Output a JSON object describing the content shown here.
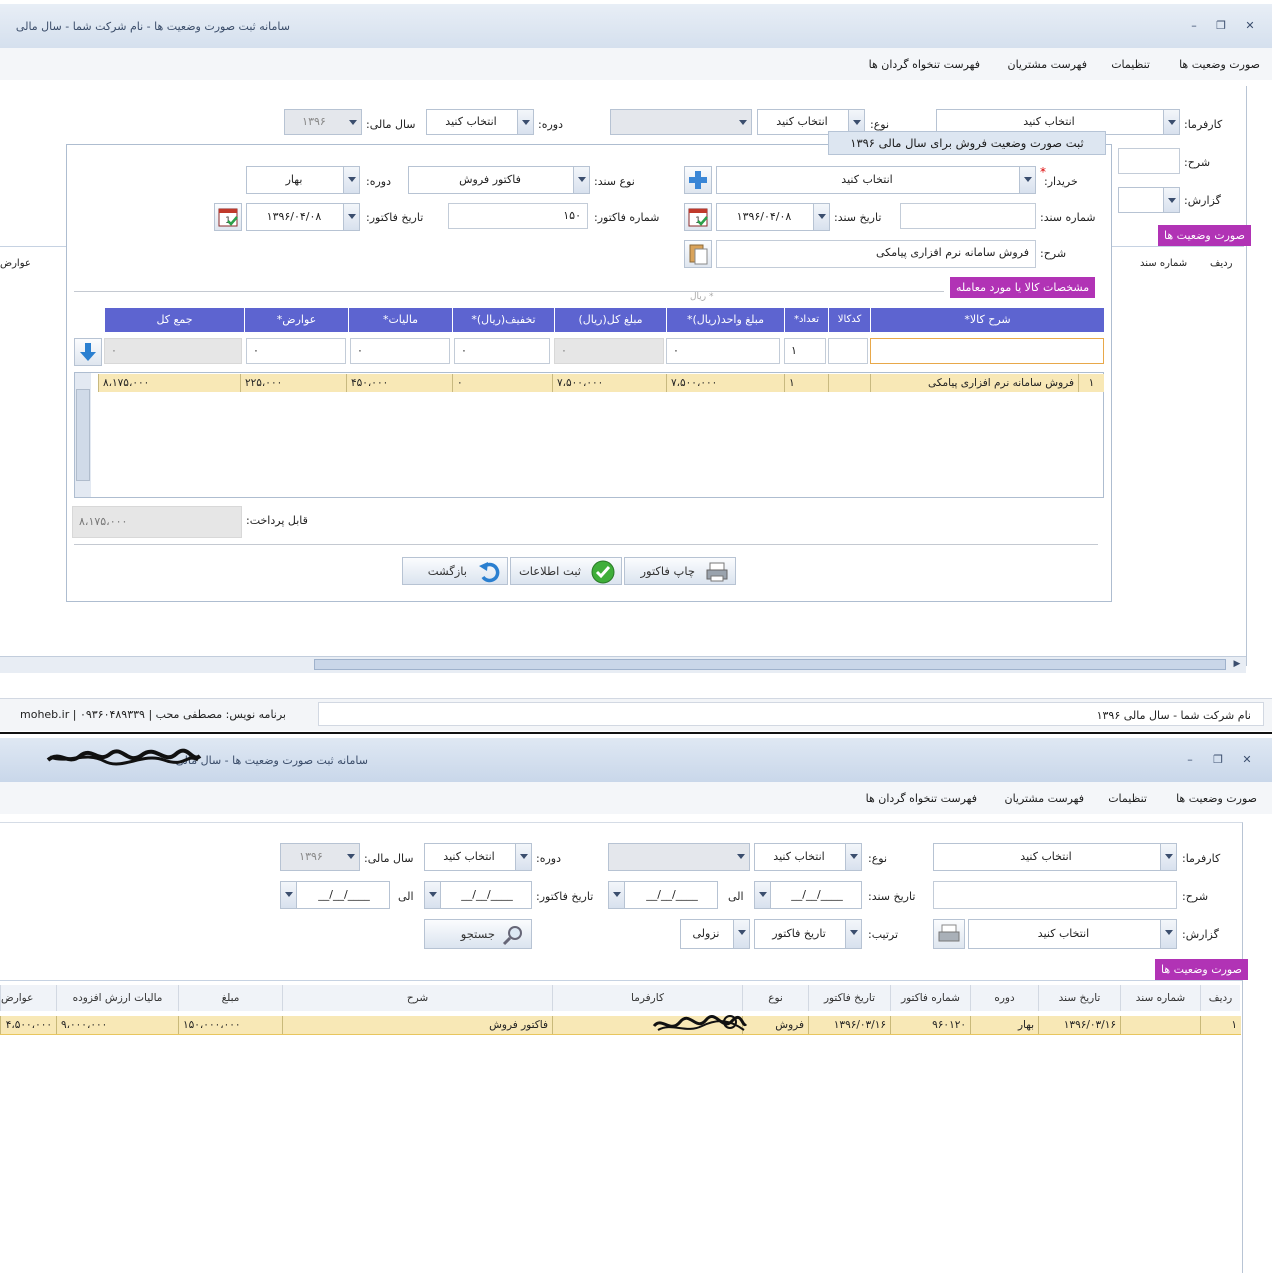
{
  "top": {
    "window_title": "سامانه ثبت صورت وضعیت ها - نام شرکت شما - سال مالی",
    "menu": [
      "صورت وضعیت ها",
      "تنظیمات",
      "فهرست مشتریان",
      "فهرست تنخواه گردان ها"
    ],
    "filters": {
      "employer_label": "کارفرما:",
      "employer_value": "انتخاب کنید",
      "type_label": "نوع:",
      "type_value": "انتخاب کنید",
      "period_label": "دوره:",
      "period_value": "انتخاب کنید",
      "fiscal_label": "سال مالی:",
      "fiscal_value": "۱۳۹۶",
      "desc_label": "شرح:",
      "report_label": "گزارش:",
      "side_tab": "صورت وضعیت ها",
      "col_row": "ردیف",
      "col_docnum": "شماره سند",
      "col_left": "عوارض"
    },
    "dialog": {
      "title": "ثبت صورت وضعیت فروش برای سال مالی ۱۳۹۶",
      "buyer_label": "خریدار:",
      "buyer_value": "انتخاب کنید",
      "doctype_label": "نوع سند:",
      "doctype_value": "فاکتور فروش",
      "period_label": "دوره:",
      "period_value": "بهار",
      "docnum_label": "شماره سند:",
      "docnum_value": "",
      "docdate_label": "تاریخ سند:",
      "docdate_value": "۱۳۹۶/۰۴/۰۸",
      "invnum_label": "شماره فاکتور:",
      "invnum_value": "۱۵۰",
      "invdate_label": "تاریخ فاکتور:",
      "invdate_value": "۱۳۹۶/۰۴/۰۸",
      "desc_label": "شرح:",
      "desc_value": "فروش سامانه نرم افزاری پیامکی",
      "goods_header": "مشخصات کالا یا مورد معامله",
      "rial_hint": "* ریال",
      "columns": [
        "شرح کالا*",
        "کدکالا",
        "تعداد*",
        "مبلغ واحد(ریال)*",
        "مبلغ کل(ریال)",
        "تخفیف(ریال)*",
        "مالیات*",
        "عوارض*",
        "جمع کل"
      ],
      "input_row": [
        "",
        "",
        "۱",
        "۰",
        "۰",
        "۰",
        "۰",
        "۰",
        "۰"
      ],
      "items": [
        {
          "idx": "۱",
          "desc": "فروش سامانه نرم افزاری پیامکی",
          "code": "",
          "qty": "۱",
          "unit": "۷،۵۰۰،۰۰۰",
          "total": "۷،۵۰۰،۰۰۰",
          "discount": "۰",
          "tax": "۴۵۰،۰۰۰",
          "duties": "۲۲۵،۰۰۰",
          "sum": "۸،۱۷۵،۰۰۰"
        }
      ],
      "payable_label": "قابل پرداخت:",
      "payable_value": "۸،۱۷۵،۰۰۰",
      "btn_print": "چاپ فاکتور",
      "btn_save": "ثبت اطلاعات",
      "btn_back": "بازگشت"
    },
    "status_left": "برنامه نویس: مصطفی محب | ۰۹۳۶۰۴۸۹۳۳۹ | moheb.ir",
    "status_right": "نام شرکت شما - سال مالی ۱۳۹۶"
  },
  "bottom": {
    "window_title": "سامانه ثبت صورت وضعیت ها - سال مالی",
    "menu": [
      "صورت وضعیت ها",
      "تنظیمات",
      "فهرست مشتریان",
      "فهرست تنخواه گردان ها"
    ],
    "filters": {
      "employer_label": "کارفرما:",
      "employer_value": "انتخاب کنید",
      "type_label": "نوع:",
      "type_value": "انتخاب کنید",
      "period_label": "دوره:",
      "period_value": "انتخاب کنید",
      "fiscal_label": "سال مالی:",
      "fiscal_value": "۱۳۹۶",
      "desc_label": "شرح:",
      "docdate_label": "تاریخ سند:",
      "to_label": "الی",
      "invdate_label": "تاریخ فاکتور:",
      "date_placeholder": "____/__/__",
      "report_label": "گزارش:",
      "report_value": "انتخاب کنید",
      "sort_label": "ترتیب:",
      "sort_value": "تاریخ فاکتور",
      "order_value": "نزولی",
      "search_btn": "جستجو",
      "side_tab": "صورت وضعیت ها"
    },
    "grid": {
      "columns": [
        "ردیف",
        "شماره سند",
        "تاریخ سند",
        "دوره",
        "شماره فاکتور",
        "تاریخ فاکتور",
        "نوع",
        "کارفرما",
        "شرح",
        "مبلغ",
        "مالیات ارزش افزوده",
        "عوارض"
      ],
      "rows": [
        {
          "idx": "۱",
          "docnum": "",
          "docdate": "۱۳۹۶/۰۳/۱۶",
          "period": "بهار",
          "invnum": "۹۶۰۱۲۰",
          "invdate": "۱۳۹۶/۰۳/۱۶",
          "type": "فروش",
          "employer": "",
          "desc": "فاکتور فروش",
          "amount": "۱۵۰،۰۰۰،۰۰۰",
          "vat": "۹،۰۰۰،۰۰۰",
          "duties": "۴،۵۰۰،۰۰۰"
        }
      ]
    }
  }
}
